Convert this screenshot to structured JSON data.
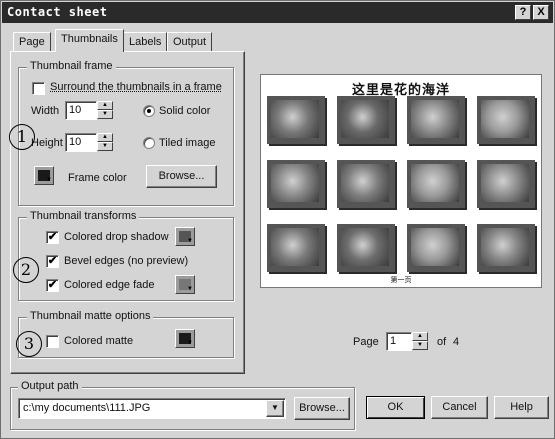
{
  "window": {
    "title": "Contact sheet",
    "help_glyph": "?",
    "close_glyph": "X"
  },
  "tabs": [
    {
      "label": "Page"
    },
    {
      "label": "Thumbnails"
    },
    {
      "label": "Labels"
    },
    {
      "label": "Output"
    }
  ],
  "thumbnail_frame": {
    "group_label": "Thumbnail frame",
    "surround_label": "Surround the thumbnails in a frame",
    "surround_checked": "",
    "width_label": "Width",
    "width_value": "10",
    "height_label": "Height",
    "height_value": "10",
    "solid_color_label": "Solid color",
    "tiled_image_label": "Tiled image",
    "frame_color_label": "Frame color",
    "frame_color": "#1a1a1a",
    "browse_label": "Browse..."
  },
  "thumbnail_transforms": {
    "group_label": "Thumbnail transforms",
    "drop_shadow_label": "Colored drop shadow",
    "drop_shadow_checked": "✔",
    "bevel_label": "Bevel edges (no preview)",
    "bevel_checked": "✔",
    "edge_fade_label": "Colored edge fade",
    "edge_fade_checked": "✔",
    "shadow_color": "#555555",
    "fade_color": "#777777"
  },
  "thumbnail_matte": {
    "group_label": "Thumbnail matte options",
    "matte_label": "Colored matte",
    "matte_checked": "",
    "matte_color": "#1a1a1a"
  },
  "annotations": {
    "one": "1",
    "two": "2",
    "three": "3"
  },
  "preview": {
    "title": "这里是花的海洋",
    "footer": "第一页",
    "thumb_count": 12
  },
  "pager": {
    "page_label": "Page",
    "page_value": "1",
    "of_label": "of",
    "total": "4"
  },
  "output_path": {
    "group_label": "Output path",
    "value": "c:\\my documents\\111.JPG",
    "browse_label": "Browse..."
  },
  "buttons": {
    "ok": "OK",
    "cancel": "Cancel",
    "help": "Help"
  }
}
